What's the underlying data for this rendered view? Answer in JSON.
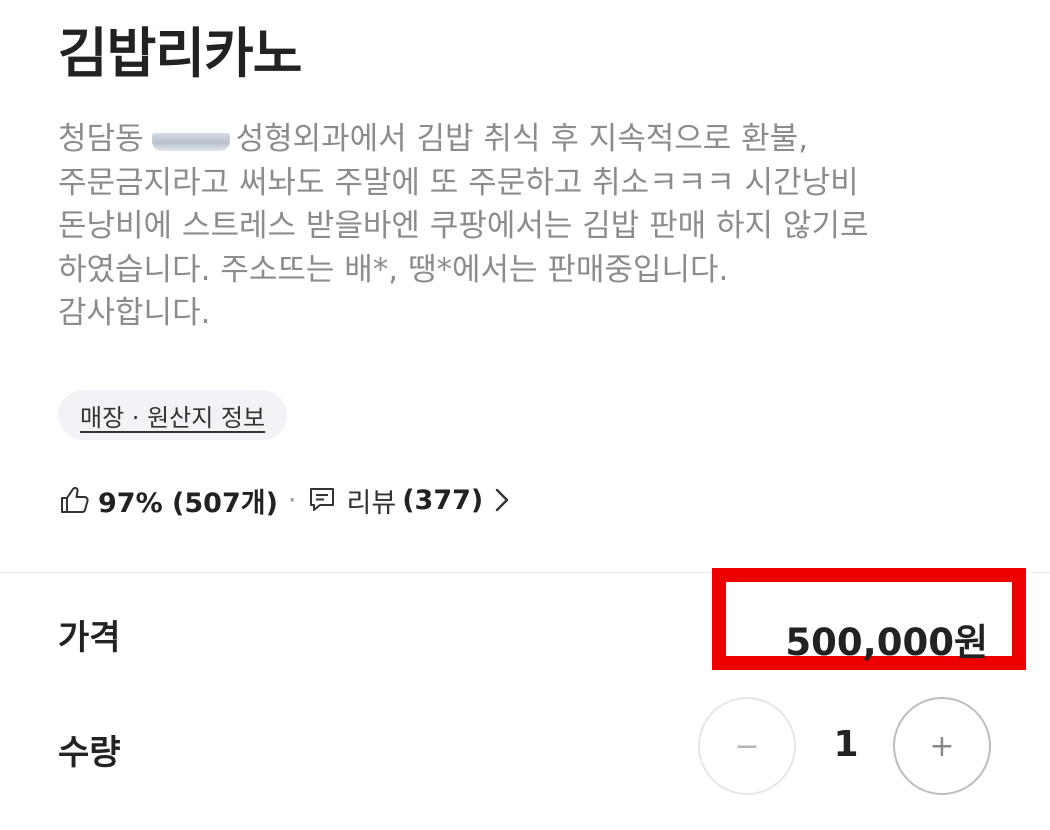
{
  "product": {
    "title": "김밥리카노",
    "description": {
      "line1_before_redaction": "청담동",
      "line1_after_redaction": "성형외과에서 김밥 취식 후 지속적으로 환불,",
      "line2": "주문금지라고 써놔도 주말에 또 주문하고 취소ㅋㅋㅋ 시간낭비",
      "line3": "돈낭비에 스트레스 받을바엔 쿠팡에서는 김밥 판매 하지 않기로",
      "line4": "하였습니다. 주소뜨는 배*, 땡*에서는 판매중입니다.",
      "line5": "감사합니다."
    },
    "store_info_chip": "매장 · 원산지 정보",
    "stats": {
      "like_icon": "thumbs-up-icon",
      "like_summary": "97% (507개)",
      "separator": "·",
      "review_icon": "comment-icon",
      "review_label": "리뷰",
      "review_count": "(377)",
      "chevron_icon": "chevron-right-icon"
    }
  },
  "order": {
    "price_label": "가격",
    "price_value": "500,000원",
    "quantity_label": "수량",
    "quantity_value": "1",
    "minus_label": "−",
    "plus_label": "+"
  },
  "colors": {
    "highlight_box": "#ee0000",
    "description_text": "#8c8c8c",
    "chip_background": "#f1f3f6"
  }
}
